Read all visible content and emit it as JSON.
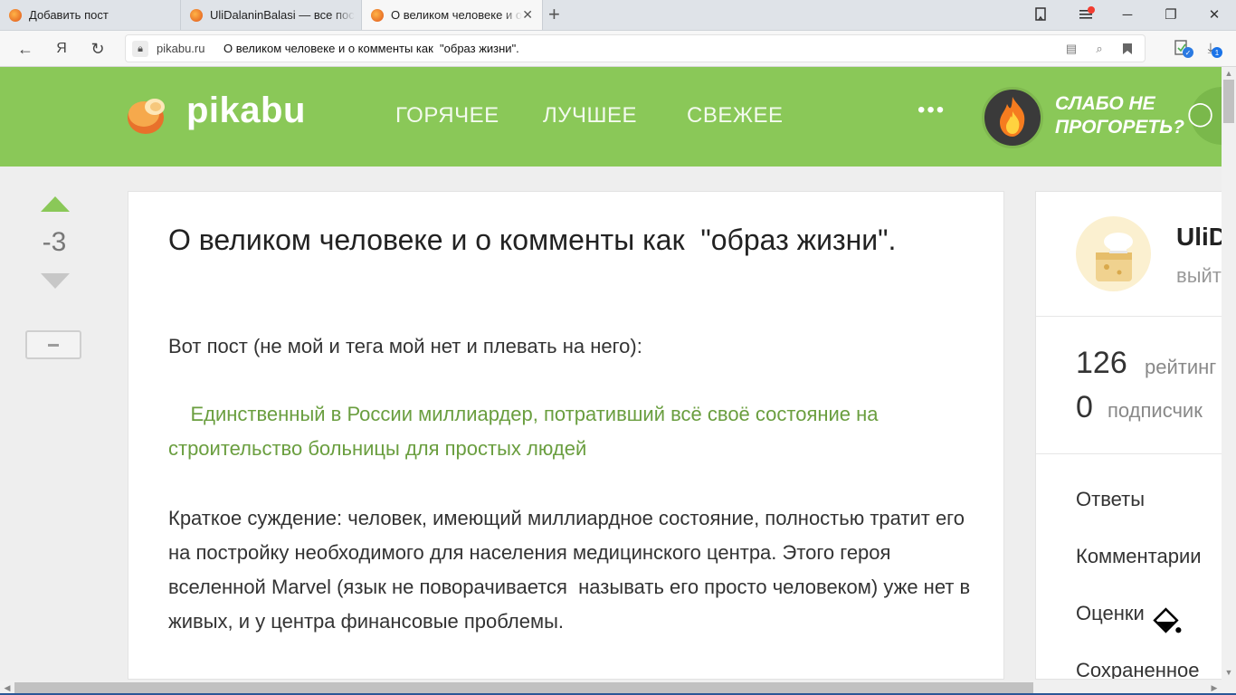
{
  "browser": {
    "tabs": [
      {
        "title": "Добавить пост",
        "active": false
      },
      {
        "title": "UliDalaninBalasi — все пос",
        "active": false
      },
      {
        "title": "О великом человеке и о",
        "active": true
      }
    ],
    "new_tab_symbol": "+",
    "address": {
      "host": "pikabu.ru",
      "page_title": "О великом человеке и о комменты как  \"образ жизни\"."
    },
    "yandex_button": "Я",
    "downloads_badge": "1"
  },
  "site": {
    "logo_text": "pikabu",
    "nav": [
      "ГОРЯЧЕЕ",
      "ЛУЧШЕЕ",
      "СВЕЖЕЕ"
    ],
    "more": "•••",
    "promo_line1": "СЛАБО НЕ",
    "promo_line2": "ПРОГОРЕТЬ?",
    "brand_color": "#8ac858"
  },
  "story": {
    "rating": "-3",
    "title": "О великом человеке и о комменты как  \"образ жизни\".",
    "intro": "Вот пост (не мой и тега мой нет и плевать на него):",
    "link_text": "Единственный в России миллиардер, потративший всё своё состояние на строительство больницы для простых людей",
    "body": "Краткое суждение: человек, имеющий миллиардное состояние, полностью тратит его на постройку необходимого для населения медицинского центра. Этого героя вселенной Marvel (язык не поворачивается  называть его просто человеком) уже нет в живых, и у центра финансовые проблемы."
  },
  "profile": {
    "username": "UliD",
    "logout": "выйт",
    "rating_value": "126",
    "rating_label": "рейтинг",
    "subscribers_value": "0",
    "subscribers_label": "подписчик",
    "links": [
      "Ответы",
      "Комментарии",
      "Оценки",
      "Сохраненное"
    ]
  }
}
